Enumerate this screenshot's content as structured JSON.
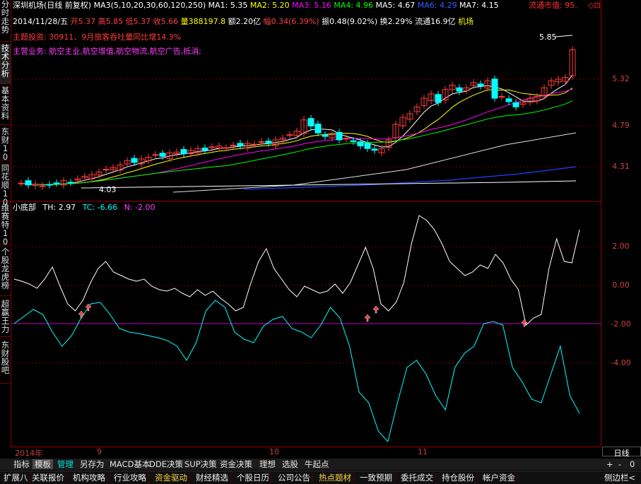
{
  "side_tabs": [
    "分时走势",
    "技术分析",
    "基本资料",
    "东财10",
    "同花顺10",
    "维赛特10",
    "个股龙虎榜",
    "超赢王力",
    "东财股吧"
  ],
  "header": {
    "title": "深圳机场(日线 前复权)",
    "ma3_params": "MA3(5,10,20,30,60,120,250)",
    "ma1": "MA1: 5.35",
    "ma2": "MA2: 5.20",
    "ma3": "MA3: 5.16",
    "ma4": "MA4: 4.96",
    "ma5": "MA5: 4.67",
    "ma6": "MA6: 4.29",
    "ma7": "MA7: 4.15",
    "market_value": "流通市值: 95.",
    "row2_date": "2014/11/28/五",
    "row2_open": "开5.37",
    "row2_high": "高5.85",
    "row2_low": "低5.37",
    "row2_close": "收5.66",
    "row2_volume": "量388197.8",
    "row2_amount": "额2.20亿",
    "row2_change": "幅0.34(6.39%)",
    "row2_amplitude": "振0.48(9.02%)",
    "row2_turnover": "换2.29%",
    "row2_float": "流通16.9亿",
    "row2_industry": "机场",
    "theme": "主题投资: 30911、9月旅客吞吐量同比增14.3%",
    "business": "主营业务: 航空主业,航空增值,航空物流,航空广告,抵消;",
    "high_label": "5.85",
    "low_label": "4.03",
    "indicator_line": "小底部",
    "th": "TH: 2.97",
    "tc": "TC: -6.66",
    "n": "N: -2.00"
  },
  "price_axis": [
    "5.32",
    "4.79",
    "4.31"
  ],
  "osc_axis": [
    "2.00",
    "0.00",
    "-2.00",
    "-4.00"
  ],
  "date_axis": [
    "2014年",
    "9",
    "10",
    "11"
  ],
  "period_label": "日线",
  "zoom_buttons": [
    "+",
    "-",
    "0"
  ],
  "toolbar": [
    "指标",
    "模板",
    "管理",
    "另存为",
    "MACD基本",
    "DDE决策",
    "SUP决策",
    "资金决策",
    "理想",
    "选股",
    "牛起点"
  ],
  "bottom_tabs": [
    "扩展八",
    "关联报价",
    "机构攻略",
    "行业攻略",
    "资金驱动",
    "财经精选",
    "个股日历",
    "公司公告",
    "热点题材",
    "一致预期",
    "委托成交",
    "持仓股份",
    "帐户资金"
  ],
  "right_bottom": "侧边栏<",
  "colors": {
    "up": "#ff3c3c",
    "down": "#00ffff",
    "ma1": "#ffffff",
    "ma2": "#ffff00",
    "ma3": "#ff00ff",
    "ma4": "#00ff00",
    "ma5": "#e0e0e0",
    "ma6": "#2040ff",
    "tc": "#00ffff",
    "n": "#ff00ff"
  }
}
